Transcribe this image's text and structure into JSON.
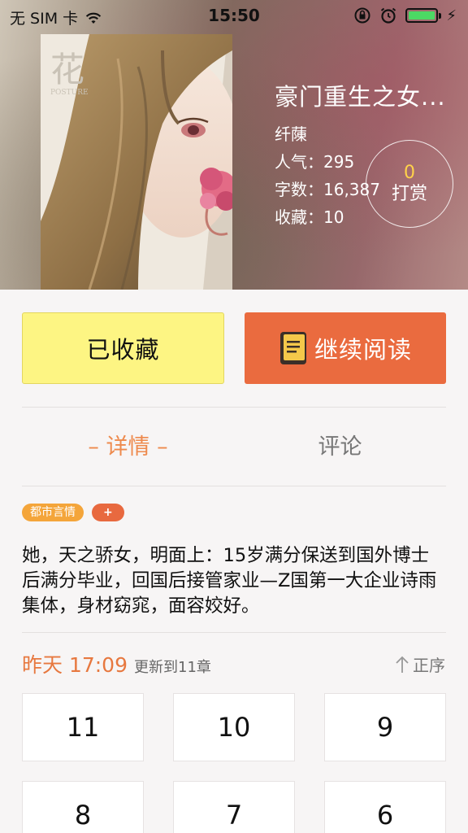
{
  "status_bar": {
    "carrier": "无 SIM 卡",
    "time": "15:50"
  },
  "book": {
    "title": "豪门重生之女...",
    "author": "纤蔯",
    "popularity": "人气：295",
    "word_count": "字数：16,387",
    "favorites": "收藏：10",
    "cover_text": "花",
    "cover_subtext": "POSTURE"
  },
  "reward": {
    "count": "0",
    "label": "打赏"
  },
  "actions": {
    "favorited_label": "已收藏",
    "continue_label": "继续阅读"
  },
  "tabs": [
    {
      "label": "– 详情 –",
      "active": true
    },
    {
      "label": "评论",
      "active": false
    }
  ],
  "tags": {
    "genre": "都市言情",
    "add": "+"
  },
  "summary": "  她，天之骄女，明面上：15岁满分保送到国外博士后满分毕业，回国后接管家业—Z国第一大企业诗雨集体，身材窈窕，面容姣好。",
  "update": {
    "time": "昨天 17:09",
    "text": "更新到11章",
    "sort_label": "正序"
  },
  "chapters": [
    "11",
    "10",
    "9",
    "8",
    "7",
    "6"
  ],
  "colors": {
    "accent_orange": "#ea6b3f",
    "favorite_yellow": "#fdf583",
    "tab_active": "#ee8a4d",
    "reward_count": "#ffd24a"
  }
}
